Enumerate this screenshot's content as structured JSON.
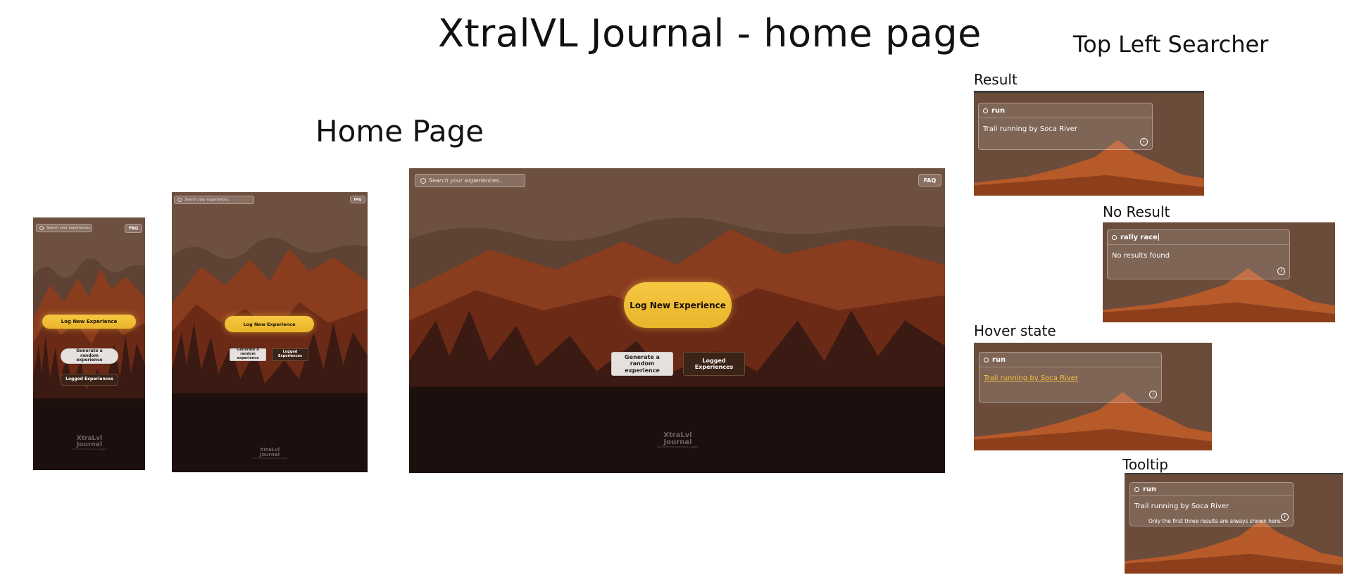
{
  "headings": {
    "title": "XtralVL Journal - home page",
    "home_page": "Home Page",
    "top_left_searcher": "Top Left Searcher",
    "result": "Result",
    "no_result": "No Result",
    "hover_state": "Hover state",
    "tooltip": "Tooltip"
  },
  "home": {
    "search_placeholder": "Search your experiences..",
    "faq": "FAQ",
    "log_new": "Log New Experience",
    "generate_random": "Generate a random experience",
    "logged_experiences": "Logged Experiences",
    "logo_line1": "XtraLvl",
    "logo_line2": "Journal",
    "logo_tagline": "Your Extreme Experience Logged"
  },
  "searcher": {
    "result": {
      "query": "run",
      "item": "Trail running by Soca River"
    },
    "no_result": {
      "query": "rally race",
      "message": "No results found"
    },
    "hover": {
      "query": "run",
      "item": "Trail running by Soca River"
    },
    "tooltip": {
      "query": "run",
      "item": "Trail running by Soca River",
      "tip": "Only the first three results are always shown here."
    },
    "info_glyph": "i"
  },
  "colors": {
    "accent_yellow": "#f3c23a",
    "sky": "#6b4c3b"
  }
}
